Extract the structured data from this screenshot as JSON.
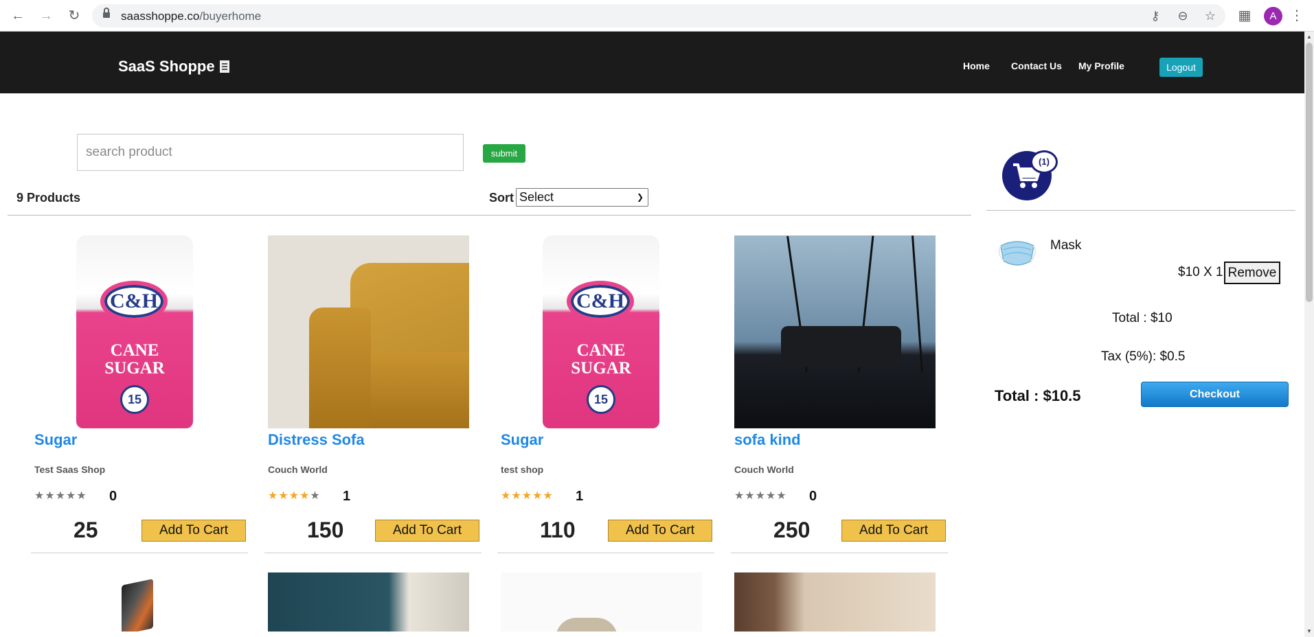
{
  "browser": {
    "url_host": "saasshoppe.co",
    "url_path": "/buyerhome",
    "avatar_letter": "A"
  },
  "header": {
    "brand": "SaaS Shoppe",
    "nav": [
      "Home",
      "Contact Us",
      "My Profile"
    ],
    "logout": "Logout"
  },
  "search": {
    "placeholder": "search product",
    "submit": "submit"
  },
  "listing": {
    "count_label": "9 Products",
    "sort_label": "Sort",
    "sort_selected": "Select"
  },
  "products": [
    {
      "name": "Sugar",
      "shop": "Test Saas Shop",
      "stars": 0,
      "rating_count": "0",
      "price": "25",
      "add": "Add To Cart"
    },
    {
      "name": "Distress Sofa",
      "shop": "Couch World",
      "stars": 4,
      "rating_count": "1",
      "price": "150",
      "add": "Add To Cart"
    },
    {
      "name": "Sugar",
      "shop": "test shop",
      "stars": 5,
      "rating_count": "1",
      "price": "110",
      "add": "Add To Cart"
    },
    {
      "name": "sofa kind",
      "shop": "Couch World",
      "stars": 0,
      "rating_count": "0",
      "price": "250",
      "add": "Add To Cart"
    }
  ],
  "sugar_art": {
    "logo": "C&H",
    "line1": "CANE",
    "line2": "SUGAR",
    "cal": "15"
  },
  "cart": {
    "badge": "(1)",
    "item_name": "Mask",
    "item_qty": "$10 X 1",
    "remove": "Remove",
    "total": "Total : $10",
    "tax": "Tax (5%): $0.5",
    "grand_total": "Total : $10.5",
    "checkout": "Checkout"
  },
  "colors": {
    "header_bg": "#1b1b1b",
    "link_blue": "#1e88e5",
    "add_cart_yellow": "#f0c14b",
    "logout_teal": "#17a2b8",
    "submit_green": "#28a745",
    "cart_navy": "#1a1f7a",
    "star_on": "#f5a623"
  }
}
